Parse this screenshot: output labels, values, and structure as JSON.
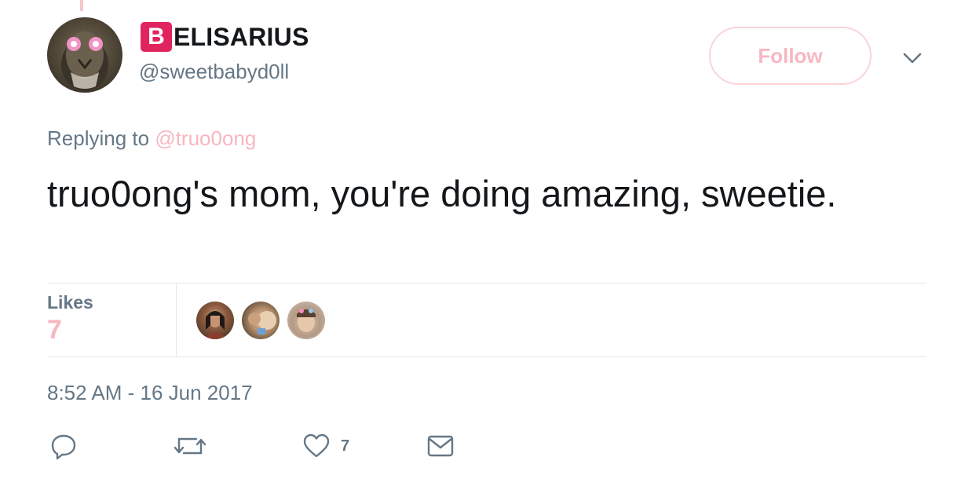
{
  "tweet": {
    "author": {
      "badge_letter": "B",
      "name_rest": "ELISARIUS",
      "handle": "@sweetbabyd0ll"
    },
    "follow_label": "Follow",
    "replying_prefix": "Replying to",
    "replying_to": "@truo0ong",
    "text": "truo0ong's mom, you're doing amazing, sweetie.",
    "likes_label": "Likes",
    "likes_count": "7",
    "timestamp": "8:52 AM - 16 Jun 2017",
    "actions": {
      "like_count": "7"
    }
  },
  "icons": {
    "caret": "chevron-down-icon",
    "reply": "reply-icon",
    "retweet": "retweet-icon",
    "like": "heart-icon",
    "message": "envelope-icon"
  },
  "colors": {
    "badge": "#e0245e",
    "accent_faded": "#f7b7c0",
    "secondary_text": "#657786",
    "primary_text": "#14171a"
  }
}
